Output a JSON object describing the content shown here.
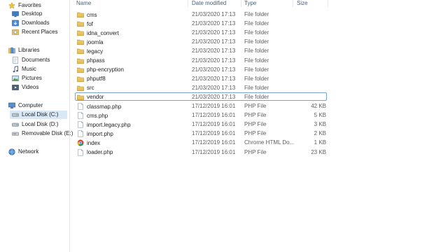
{
  "sidebar": {
    "favorites_label": "Favorites",
    "favorites": [
      {
        "label": "Desktop",
        "icon": "desktop-icon"
      },
      {
        "label": "Downloads",
        "icon": "downloads-icon"
      },
      {
        "label": "Recent Places",
        "icon": "recent-places-icon"
      }
    ],
    "libraries_label": "Libraries",
    "libraries": [
      {
        "label": "Documents",
        "icon": "documents-icon"
      },
      {
        "label": "Music",
        "icon": "music-icon"
      },
      {
        "label": "Pictures",
        "icon": "pictures-icon"
      },
      {
        "label": "Videos",
        "icon": "videos-icon"
      }
    ],
    "computer_label": "Computer",
    "drives": [
      {
        "label": "Local Disk (C:)",
        "icon": "local-disk-icon",
        "selected": true
      },
      {
        "label": "Local Disk (D:)",
        "icon": "local-disk-icon",
        "selected": false
      },
      {
        "label": "Removable Disk (E:)",
        "icon": "removable-disk-icon",
        "selected": false
      }
    ],
    "network_label": "Network"
  },
  "columns": {
    "name": "Name",
    "date": "Date modified",
    "type": "Type",
    "size": "Size"
  },
  "files": [
    {
      "name": "cms",
      "date": "21/03/2020 17:13",
      "type": "File folder",
      "size": "",
      "icon": "folder-icon"
    },
    {
      "name": "fof",
      "date": "21/03/2020 17:13",
      "type": "File folder",
      "size": "",
      "icon": "folder-icon"
    },
    {
      "name": "idna_convert",
      "date": "21/03/2020 17:13",
      "type": "File folder",
      "size": "",
      "icon": "folder-icon"
    },
    {
      "name": "joomla",
      "date": "21/03/2020 17:13",
      "type": "File folder",
      "size": "",
      "icon": "folder-icon"
    },
    {
      "name": "legacy",
      "date": "21/03/2020 17:13",
      "type": "File folder",
      "size": "",
      "icon": "folder-icon"
    },
    {
      "name": "phpass",
      "date": "21/03/2020 17:13",
      "type": "File folder",
      "size": "",
      "icon": "folder-icon"
    },
    {
      "name": "php-encryption",
      "date": "21/03/2020 17:13",
      "type": "File folder",
      "size": "",
      "icon": "folder-icon"
    },
    {
      "name": "phputf8",
      "date": "21/03/2020 17:13",
      "type": "File folder",
      "size": "",
      "icon": "folder-icon"
    },
    {
      "name": "src",
      "date": "21/03/2020 17:13",
      "type": "File folder",
      "size": "",
      "icon": "folder-icon"
    },
    {
      "name": "vendor",
      "date": "21/03/2020 17:13",
      "type": "File folder",
      "size": "",
      "icon": "folder-icon",
      "focused": true
    },
    {
      "name": "classmap.php",
      "date": "17/12/2019 16:01",
      "type": "PHP File",
      "size": "42 KB",
      "icon": "php-file-icon"
    },
    {
      "name": "cms.php",
      "date": "17/12/2019 16:01",
      "type": "PHP File",
      "size": "5 KB",
      "icon": "php-file-icon"
    },
    {
      "name": "import.legacy.php",
      "date": "17/12/2019 16:01",
      "type": "PHP File",
      "size": "3 KB",
      "icon": "php-file-icon"
    },
    {
      "name": "import.php",
      "date": "17/12/2019 16:01",
      "type": "PHP File",
      "size": "2 KB",
      "icon": "php-file-icon"
    },
    {
      "name": "index",
      "date": "17/12/2019 16:01",
      "type": "Chrome HTML Do...",
      "size": "1 KB",
      "icon": "chrome-html-icon"
    },
    {
      "name": "loader.php",
      "date": "17/12/2019 16:01",
      "type": "PHP File",
      "size": "23 KB",
      "icon": "php-file-icon"
    }
  ],
  "colors": {
    "selection": "#d9e8f7",
    "focus_border": "#7da2ce",
    "folder": "#e8c15a",
    "header_text": "#4c607a"
  }
}
